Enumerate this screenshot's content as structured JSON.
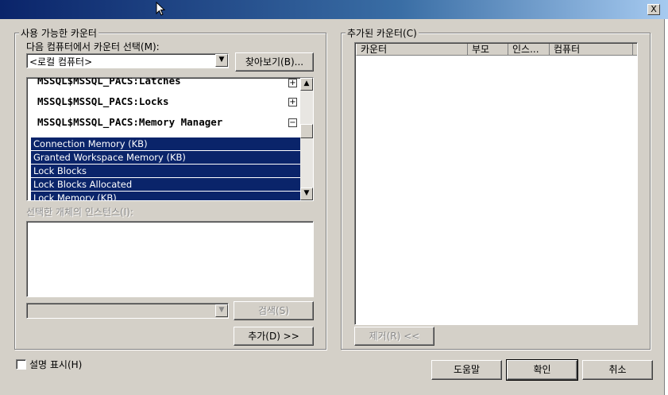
{
  "window": {
    "close_glyph": "X"
  },
  "available": {
    "group_label": "사용 가능한 카운터",
    "computer_label": "다음 컴퓨터에서 카운터 선택(M):",
    "computer_value": "<로컬 컴퓨터>",
    "browse_button": "찾아보기(B)...",
    "objects": [
      {
        "name": "MSSQL$MSSQL_PACS:Latches",
        "expander": "+"
      },
      {
        "name": "MSSQL$MSSQL_PACS:Locks",
        "expander": "+"
      },
      {
        "name": "MSSQL$MSSQL_PACS:Memory Manager",
        "expander": "−"
      }
    ],
    "counters": [
      "Connection Memory (KB)",
      "Granted Workspace Memory (KB)",
      "Lock Blocks",
      "Lock Blocks Allocated",
      "Lock Memory (KB)"
    ],
    "instances_label": "선택한 개체의 인스턴스(I):",
    "search_button": "검색(S)",
    "add_button": "추가(D) >>"
  },
  "added": {
    "group_label": "추가된 카운터(C)",
    "columns": [
      "카운터",
      "부모",
      "인스...",
      "컴퓨터"
    ],
    "remove_button": "제거(R) <<"
  },
  "show_description_label": "설명 표시(H)",
  "footer": {
    "help_button": "도움말",
    "ok_button": "확인",
    "cancel_button": "취소"
  }
}
